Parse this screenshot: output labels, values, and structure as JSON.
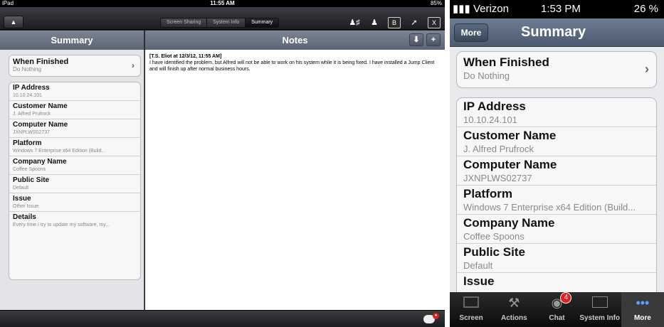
{
  "ipad": {
    "status": {
      "device": "iPad",
      "time": "11:55 AM",
      "battery": "85%"
    },
    "toolbar": {
      "up_button": "▲",
      "segments": [
        "Screen Sharing",
        "System Info",
        "Summary"
      ],
      "active_segment": "Summary",
      "icons": [
        "user-plus-icon",
        "user-icon",
        "b-icon",
        "pin-icon",
        "close-icon"
      ],
      "b_icon_label": "B",
      "close_label": "X"
    },
    "left_header": "Summary",
    "right_header": "Notes",
    "right_buttons": {
      "download": "⬇",
      "add": "+"
    },
    "when_finished": {
      "label": "When Finished",
      "value": "Do Nothing"
    },
    "fields": [
      {
        "label": "IP Address",
        "value": "10.10.24.101"
      },
      {
        "label": "Customer Name",
        "value": "J. Alfred Prufrock"
      },
      {
        "label": "Computer Name",
        "value": "JXNPLWS02737"
      },
      {
        "label": "Platform",
        "value": "Windows 7 Enterprise x64 Edition (Build..."
      },
      {
        "label": "Company Name",
        "value": "Coffee Spoons"
      },
      {
        "label": "Public Site",
        "value": "Default"
      },
      {
        "label": "Issue",
        "value": "Other Issue"
      },
      {
        "label": "Details",
        "value": "Every time I try to update my software, my..."
      }
    ],
    "note": {
      "header": "[T.S. Eliot at 12/3/12, 11:55 AM]",
      "body": "I have identified the problem, but Alfred will not be able to work on his system while it is being fixed. I have installed a Jump Client and will finish up after normal business hours."
    }
  },
  "iphone": {
    "status": {
      "carrier": "Verizon",
      "time": "1:53 PM",
      "battery": "26 %"
    },
    "back_button": "More",
    "title": "Summary",
    "when_finished": {
      "label": "When Finished",
      "value": "Do Nothing"
    },
    "fields": [
      {
        "label": "IP Address",
        "value": "10.10.24.101"
      },
      {
        "label": "Customer Name",
        "value": "J. Alfred Prufrock"
      },
      {
        "label": "Computer Name",
        "value": "JXNPLWS02737"
      },
      {
        "label": "Platform",
        "value": "Windows 7 Enterprise x64 Edition (Build..."
      },
      {
        "label": "Company Name",
        "value": "Coffee Spoons"
      },
      {
        "label": "Public Site",
        "value": "Default"
      },
      {
        "label": "Issue",
        "value": ""
      }
    ],
    "tabs": [
      {
        "label": "Screen",
        "icon": "monitor-icon"
      },
      {
        "label": "Actions",
        "icon": "tools-icon"
      },
      {
        "label": "Chat",
        "icon": "chat-icon",
        "badge": "4"
      },
      {
        "label": "System Info",
        "icon": "chart-icon"
      },
      {
        "label": "More",
        "icon": "more-icon",
        "active": true
      }
    ]
  }
}
